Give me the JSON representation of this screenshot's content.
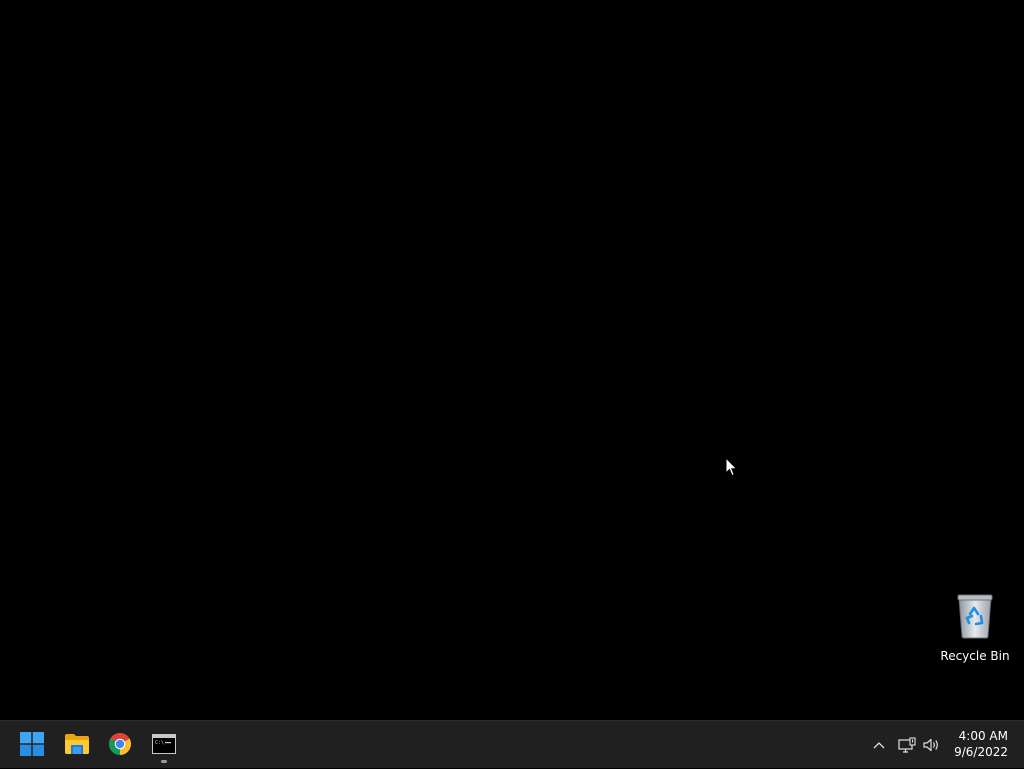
{
  "desktop": {
    "background_color": "#000000",
    "icons": [
      {
        "label": "Recycle Bin",
        "icon": "recycle-bin-icon"
      }
    ]
  },
  "taskbar": {
    "background_color": "#202020",
    "apps": [
      {
        "name": "Start",
        "icon": "windows-logo-icon",
        "running": false
      },
      {
        "name": "File Explorer",
        "icon": "folder-icon",
        "running": false
      },
      {
        "name": "Google Chrome",
        "icon": "chrome-icon",
        "running": false
      },
      {
        "name": "Command Prompt",
        "icon": "terminal-icon",
        "running": true
      }
    ],
    "tray": {
      "icons": [
        "chevron-up-icon",
        "network-icon",
        "volume-icon"
      ],
      "time": "4:00 AM",
      "date": "9/6/2022"
    }
  }
}
